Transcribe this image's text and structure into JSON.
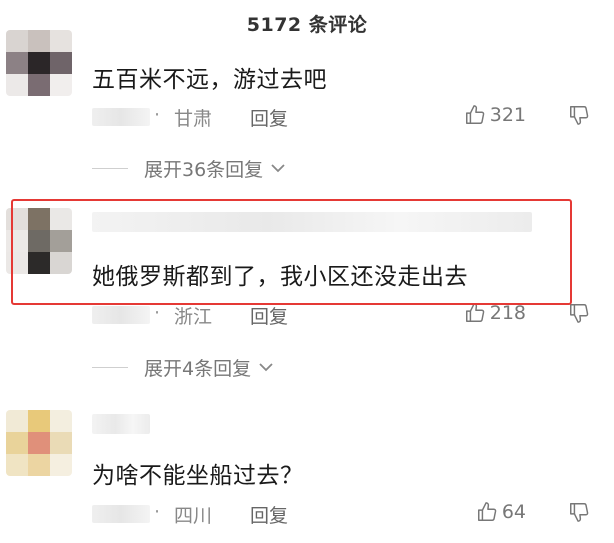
{
  "header": {
    "title": "5172 条评论"
  },
  "comments": [
    {
      "text": "五百米不远，游过去吧",
      "dot": "·",
      "location": "甘肃",
      "reply_label": "回复",
      "likes": "321",
      "expand_label": "展开36条回复"
    },
    {
      "text": "她俄罗斯都到了，我小区还没走出去",
      "dot": "·",
      "location": "浙江",
      "reply_label": "回复",
      "likes": "218",
      "expand_label": "展开4条回复"
    },
    {
      "text": "为啥不能坐船过去？",
      "dot": "·",
      "location": "四川",
      "reply_label": "回复",
      "likes": "64"
    }
  ],
  "icons": {
    "like": "thumbs-up-icon",
    "dislike": "thumbs-down-icon",
    "expand": "chevron-down-icon"
  },
  "colors": {
    "highlight_border": "#e53935",
    "meta_text": "#7a7a7a",
    "body_text": "#1a1a1a"
  }
}
